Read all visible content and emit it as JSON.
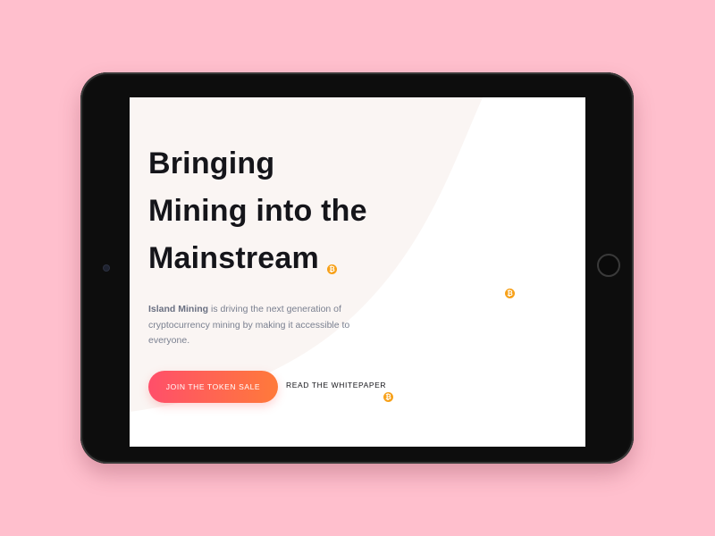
{
  "hero": {
    "title_lines": [
      "Bringing",
      "Mining into the",
      "Mainstream"
    ],
    "description_brand": "Island Mining",
    "description_rest": " is driving the next generation of cryptocurrency mining by making it accessible to everyone.",
    "primary_cta": "JOIN THE TOKEN SALE",
    "secondary_cta": "READ THE WHITEPAPER"
  },
  "icons": {
    "coin_glyph": "₿",
    "coin_color": "#f7a11a"
  },
  "colors": {
    "page_background": "#ffbfcd",
    "cta_gradient_start": "#ff4f6a",
    "cta_gradient_end": "#ff7a3a",
    "hero_shape": "#faf5f3"
  }
}
